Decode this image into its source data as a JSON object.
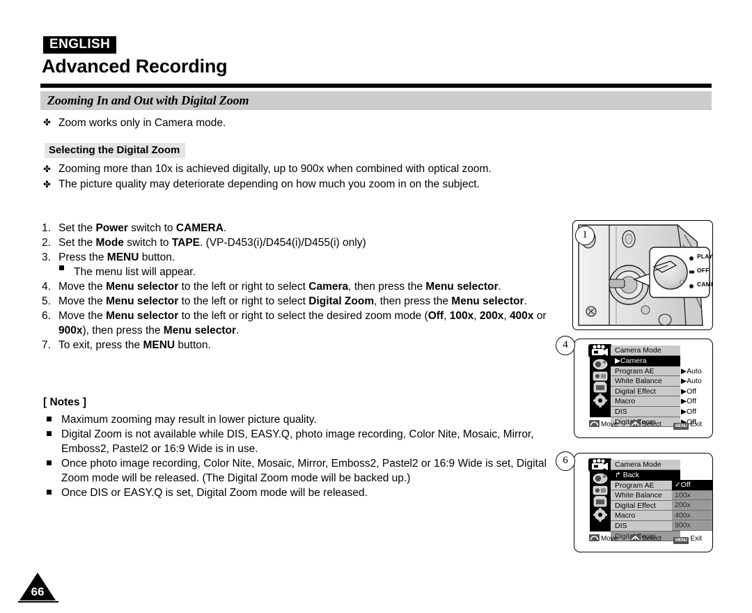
{
  "header": {
    "language_badge": "ENGLISH",
    "page_title": "Advanced Recording",
    "section_title": "Zooming In and Out with Digital Zoom"
  },
  "intro": {
    "bullet_glyph": "✤",
    "note": "Zoom works only in Camera mode."
  },
  "subsection": {
    "heading": "Selecting the Digital Zoom",
    "bullets": [
      "Zooming more than 10x is achieved digitally, up to 900x when combined with optical zoom.",
      "The picture quality may deteriorate depending on how much you zoom in on the subject."
    ]
  },
  "steps": [
    {
      "num": "1.",
      "html": "Set the <b>Power</b> switch to <b>CAMERA</b>."
    },
    {
      "num": "2.",
      "html": "Set the <b>Mode</b> switch to <b>TAPE</b>. (VP-D453(i)/D454(i)/D455(i) only)"
    },
    {
      "num": "3.",
      "html": "Press the <b>MENU</b> button."
    },
    {
      "num": "",
      "sub": true,
      "html": "The menu list will appear."
    },
    {
      "num": "4.",
      "html": "Move the <b>Menu selector</b> to the left or right to select <b>Camera</b>, then press the <b>Menu selector</b>."
    },
    {
      "num": "5.",
      "html": "Move the <b>Menu selector</b> to the left or right to select <b>Digital Zoom</b>, then press the <b>Menu selector</b>."
    },
    {
      "num": "6.",
      "html": "Move the <b>Menu selector</b> to the left or right to select the desired zoom mode (<b>Off</b>, <b>100x</b>, <b>200x</b>, <b>400x</b> or <b>900x</b>), then press the <b>Menu selector</b>."
    },
    {
      "num": "7.",
      "html": "To exit, press the <b>MENU</b> button."
    }
  ],
  "notes": {
    "heading": "[ Notes ]",
    "items": [
      "Maximum zooming may result in lower picture quality.",
      "Digital Zoom is not available while DIS, EASY.Q, photo image recording, Color Nite, Mosaic, Mirror, Emboss2, Pastel2 or 16:9 Wide is in use.",
      "Once photo image recording, Color Nite, Mosaic, Mirror, Emboss2, Pastel2 or 16:9 Wide is set, Digital Zoom mode will be released. (The Digital Zoom mode will be backed up.)",
      "Once DIS or EASY.Q is set, Digital Zoom mode will be released."
    ]
  },
  "figures": {
    "camera": {
      "marker": "1",
      "dial_labels": [
        "PLAYER",
        "OFF",
        "CAMERA"
      ],
      "selected_position": "OFF"
    },
    "menu_step4": {
      "marker": "4",
      "title": "Camera Mode",
      "rows": [
        {
          "label": "▶Camera",
          "value": "",
          "state": "selected"
        },
        {
          "label": "Program AE",
          "value": "▶Auto",
          "state": "normal"
        },
        {
          "label": "White Balance",
          "value": "▶Auto",
          "state": "normal"
        },
        {
          "label": "Digital Effect",
          "value": "▶Off",
          "state": "normal"
        },
        {
          "label": "Macro",
          "value": "▶Off",
          "state": "normal"
        },
        {
          "label": "DIS",
          "value": "▶Off",
          "state": "normal"
        },
        {
          "label": "Digital Zoom",
          "value": "▶Off",
          "state": "normal"
        }
      ],
      "footer": {
        "move": "Move",
        "select": "Select",
        "exit": "Exit",
        "menu_key": "MENU"
      }
    },
    "menu_step6": {
      "marker": "6",
      "title": "Camera Mode",
      "rows": [
        {
          "label": "↱ Back",
          "state": "selected"
        },
        {
          "label": "Program AE",
          "state": "normal"
        },
        {
          "label": "White Balance",
          "state": "normal"
        },
        {
          "label": "Digital Effect",
          "state": "normal"
        },
        {
          "label": "Macro",
          "state": "normal"
        },
        {
          "label": "DIS",
          "state": "normal"
        },
        {
          "label": "Digital Zoom",
          "state": "dim"
        }
      ],
      "submenu": [
        {
          "label": "✓Off",
          "state": "selected"
        },
        {
          "label": "100x",
          "state": "dim"
        },
        {
          "label": "200x",
          "state": "dim"
        },
        {
          "label": "400x",
          "state": "dim"
        },
        {
          "label": "900x",
          "state": "dim"
        }
      ],
      "footer": {
        "move": "Move",
        "select": "Select",
        "exit": "Exit",
        "menu_key": "MENU"
      }
    }
  },
  "page_number": "66",
  "colors": {
    "section_bar": "#cccccc",
    "subhead_bg": "#e4e4e4",
    "lcd_row": "#c9c9c9",
    "lcd_dim": "#9a9a9a",
    "ink": "#000000"
  }
}
